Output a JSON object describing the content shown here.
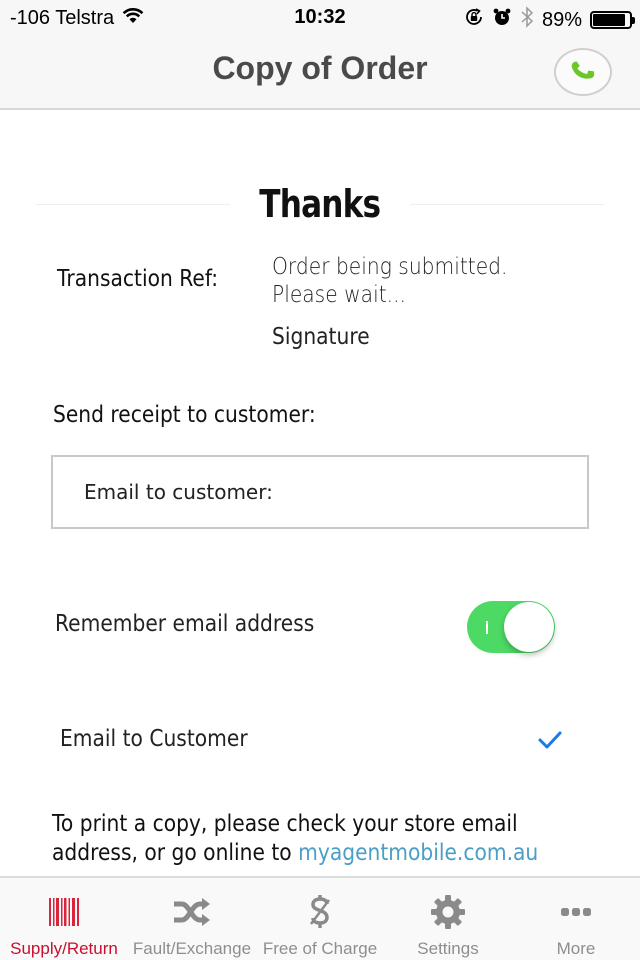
{
  "status_bar": {
    "carrier": "-106 Telstra",
    "time": "10:32",
    "battery_percent": "89%",
    "battery_level": 0.89,
    "icons": [
      "wifi-icon",
      "orientation-lock-icon",
      "alarm-icon",
      "bluetooth-icon",
      "battery-icon"
    ]
  },
  "header": {
    "title": "Copy of Order",
    "call_button_icon": "phone-icon"
  },
  "colors": {
    "accent_red": "#c8102e",
    "toggle_green": "#4cd964",
    "phone_green": "#6cc62a",
    "link_blue": "#4a9fc6",
    "check_blue": "#1a7ae8",
    "tab_inactive": "#8e8e8e"
  },
  "content": {
    "thanks_title": "Thanks",
    "transaction_ref_label": "Transaction Ref:",
    "transaction_ref_value_line1": "Order being submitted.",
    "transaction_ref_value_line2": "Please wait...",
    "signature_label": "Signature",
    "send_receipt_label": "Send receipt to customer:",
    "email_input": {
      "value": "",
      "placeholder": "Email to customer:"
    },
    "remember_email_label": "Remember email address",
    "remember_email_on": true,
    "email_to_customer_label": "Email to Customer",
    "email_to_customer_checked": true,
    "print_note_prefix": "To print a copy, please check your store email",
    "print_note_line2_prefix": "address, or go online to ",
    "print_note_link": "myagentmobile.com.au"
  },
  "tab_bar": {
    "active_index": 0,
    "tabs": [
      {
        "label": "Supply/Return",
        "icon": "barcode-icon"
      },
      {
        "label": "Fault/Exchange",
        "icon": "shuffle-icon"
      },
      {
        "label": "Free of Charge",
        "icon": "no-dollar-icon"
      },
      {
        "label": "Settings",
        "icon": "gear-icon"
      },
      {
        "label": "More",
        "icon": "more-dots-icon"
      }
    ]
  }
}
